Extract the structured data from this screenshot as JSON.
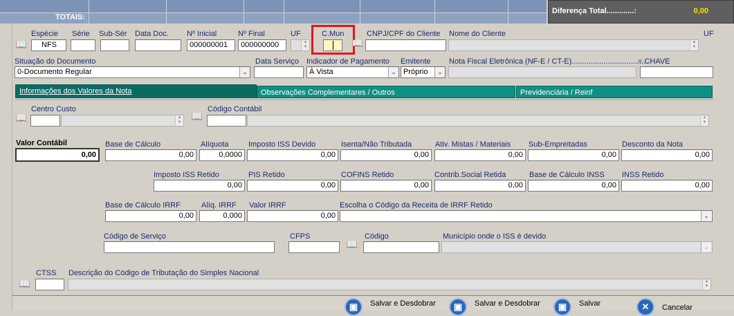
{
  "totals": {
    "label": "TOTAIS:",
    "diferenca_label": "Diferença Total.............:",
    "diferenca_value": "0,00"
  },
  "doc": {
    "especie_label": "Espécie",
    "especie_value": "NFS",
    "serie_label": "Série",
    "serie_value": "",
    "subser_label": "Sub-Sér",
    "subser_value": "",
    "datadoc_label": "Data Doc.",
    "datadoc_value": "",
    "ninicial_label": "Nº Inicial",
    "ninicial_value": "000000001",
    "nfinal_label": "Nº Final",
    "nfinal_value": "000000000",
    "uf_label": "UF",
    "uf_value": "",
    "cmun_label": "C.Mun",
    "cmun_value": "",
    "cnpj_label": "CNPJ/CPF do Cliente",
    "cnpj_value": "",
    "nome_label": "Nome do Cliente",
    "nome_value": "",
    "uf2_label": "UF"
  },
  "row2": {
    "situacao_label": "Situação do Documento",
    "situacao_value": "0-Documento Regular",
    "dataservico_label": "Data Serviço",
    "dataservico_value": "",
    "pagamento_label": "Indicador de Pagamento",
    "pagamento_value": "À Vista",
    "emitente_label": "Emitente",
    "emitente_value": "Próprio",
    "nfe_label": "Nota Fiscal Eletrônica (NF-E / CT-E)....................................",
    "chave_label": "= CHAVE",
    "chave_value": ""
  },
  "tabs": {
    "valores": "Informações dos Valores da Nota",
    "obs": "Observações Complementares / Outros",
    "prev": "Previdenciária / Reinf"
  },
  "centro": {
    "centro_label": "Centro Custo",
    "centro_value": "",
    "contabil_label": "Código Contábil",
    "contabil_value": ""
  },
  "valores": {
    "valor_contabil_label": "Valor Contábil",
    "valor_contabil": "0,00",
    "base_calculo_label": "Base de Cálculo",
    "base_calculo": "0,00",
    "aliquota_label": "Alíquota",
    "aliquota": "0,0000",
    "iss_devido_label": "Imposto ISS Devido",
    "iss_devido": "0,00",
    "isenta_label": "Isenta/Não Tributada",
    "isenta": "0,00",
    "ativ_label": "Ativ. Mistas / Materiais",
    "ativ": "0,00",
    "subemp_label": "Sub-Empreitadas",
    "subemp": "0,00",
    "desconto_label": "Desconto da Nota",
    "desconto": "0,00",
    "iss_retido_label": "Imposto ISS Retido",
    "iss_retido": "0,00",
    "pis_label": "PIS Retido",
    "pis": "0,00",
    "cofins_label": "COFINS Retido",
    "cofins": "0,00",
    "csll_label": "Contrib.Social Retida",
    "csll": "0,00",
    "inss_base_label": "Base de Cálculo INSS",
    "inss_base": "0,00",
    "inss_label": "INSS Retido",
    "inss": "0,00",
    "irrf_base_label": "Base de Cálculo IRRF",
    "irrf_base": "0,00",
    "irrf_aliq_label": "Alíq. IRRF",
    "irrf_aliq": "0,000",
    "irrf_valor_label": "Valor IRRF",
    "irrf_valor": "0,00",
    "irrf_receita_label": "Escolha o Código da Receita de IRRF Retido",
    "irrf_receita": ""
  },
  "servico": {
    "codigo_servico_label": "Código de Serviço",
    "codigo_servico": "",
    "cfps_label": "CFPS",
    "cfps": "",
    "codigo_label": "Código",
    "codigo": "",
    "municipio_label": "Município onde o ISS é devido",
    "municipio": ""
  },
  "ctss": {
    "ctss_label": "CTSS",
    "ctss": "",
    "descricao_label": "Descrição do Código de Tributação do Simples Nacional",
    "descricao": ""
  },
  "buttons": {
    "salvar_desdobrar_1": "Salvar e Desdobrar",
    "salvar_desdobrar_2": "Salvar e Desdobrar",
    "salvar": "Salvar",
    "cancelar": "Cancelar"
  }
}
